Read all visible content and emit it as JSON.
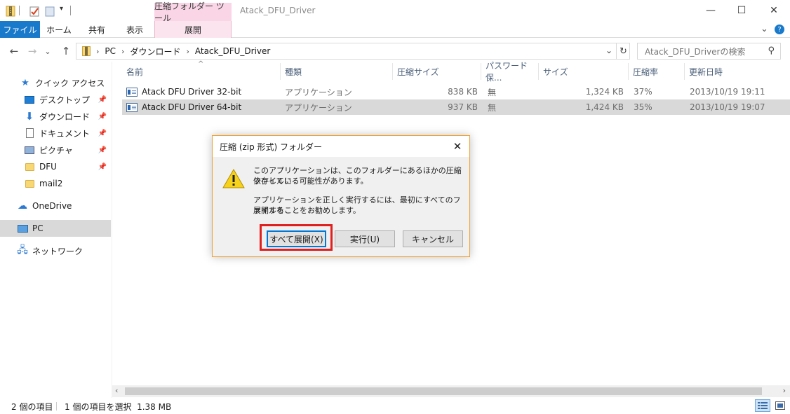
{
  "window": {
    "title": "Atack_DFU_Driver",
    "contextual_tab_group": "圧縮フォルダー ツール",
    "controls": {
      "minimize": "—",
      "maximize": "☐",
      "close": "✕"
    }
  },
  "ribbon": {
    "tabs": [
      {
        "label": "ファイル"
      },
      {
        "label": "ホーム"
      },
      {
        "label": "共有"
      },
      {
        "label": "表示"
      },
      {
        "label": "展開"
      }
    ],
    "collapse_icon": "⌄",
    "help_icon": "?"
  },
  "address": {
    "back": "←",
    "forward": "→",
    "recent": "⌄",
    "up": "↑",
    "breadcrumb": [
      "PC",
      "ダウンロード",
      "Atack_DFU_Driver"
    ],
    "dropdown": "⌄",
    "refresh": "↻",
    "search_placeholder": "Atack_DFU_Driverの検索",
    "search_icon": "⚲"
  },
  "sidebar": {
    "items": [
      {
        "label": "クイック アクセス",
        "icon": "star-icon"
      },
      {
        "label": "デスクトップ",
        "icon": "desktop-icon",
        "pinned": true
      },
      {
        "label": "ダウンロード",
        "icon": "download-icon",
        "pinned": true
      },
      {
        "label": "ドキュメント",
        "icon": "document-icon",
        "pinned": true
      },
      {
        "label": "ピクチャ",
        "icon": "picture-icon",
        "pinned": true
      },
      {
        "label": "DFU",
        "icon": "folder-icon",
        "pinned": true
      },
      {
        "label": "mail2",
        "icon": "folder-icon"
      },
      {
        "label": "OneDrive",
        "icon": "cloud-icon"
      },
      {
        "label": "PC",
        "icon": "pc-icon",
        "selected": true
      },
      {
        "label": "ネットワーク",
        "icon": "network-icon"
      }
    ]
  },
  "columns": [
    "名前",
    "種類",
    "圧縮サイズ",
    "パスワード保...",
    "サイズ",
    "圧縮率",
    "更新日時"
  ],
  "sort_indicator": "^",
  "files": [
    {
      "name": "Atack DFU Driver 32-bit",
      "type": "アプリケーション",
      "compressed": "838 KB",
      "password": "無",
      "size": "1,324 KB",
      "ratio": "37%",
      "modified": "2013/10/19 19:11",
      "selected": false
    },
    {
      "name": "Atack DFU Driver 64-bit",
      "type": "アプリケーション",
      "compressed": "937 KB",
      "password": "無",
      "size": "1,424 KB",
      "ratio": "35%",
      "modified": "2013/10/19 19:07",
      "selected": true
    }
  ],
  "status": {
    "item_count": "2 個の項目",
    "selection": "1 個の項目を選択  1.38 MB"
  },
  "dialog": {
    "title": "圧縮 (zip 形式) フォルダー",
    "close": "✕",
    "message_line1": "このアプリケーションは、このフォルダーにあるほかの圧縮ファイルに",
    "message_line2": "依存している可能性があります。",
    "message_line3": "アプリケーションを正しく実行するには、最初にすべてのファイルを",
    "message_line4": "展開することをお勧めします。",
    "buttons": {
      "extract_all": "すべて展開(X)",
      "run": "実行(U)",
      "cancel": "キャンセル"
    }
  },
  "colors": {
    "file_tab": "#1979ca",
    "context_tab": "#f9d5e5",
    "dialog_border": "#f0a030",
    "highlight": "#e0201f",
    "default_button": "#0078d7"
  }
}
